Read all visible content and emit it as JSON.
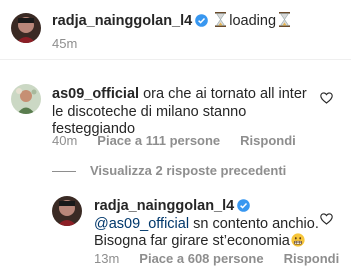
{
  "caption": {
    "username": "radja_nainggolan_l4",
    "text": "loading",
    "time": "45m",
    "icons": [
      "avatar",
      "verified-badge-icon",
      "hourglass-icon",
      "hourglass-icon"
    ]
  },
  "comments": [
    {
      "username": "as09_official",
      "text": "ora che ai tornato all inter le discoteche di milano stanno festeggiando",
      "time": "40m",
      "likes": "Piace a 111 persone",
      "reply_label": "Rispondi"
    }
  ],
  "view_replies_label": "Visualizza 2 risposte precedenti",
  "reply": {
    "username": "radja_nainggolan_l4",
    "mention": "@as09_official",
    "text_line1": " sn contento anchio.",
    "text_line2": "Bisogna far girare st’economia",
    "time": "13m",
    "likes": "Piace a 608 persone",
    "reply_label": "Rispondi"
  },
  "colors": {
    "text": "#262626",
    "muted": "#8e8e8e",
    "mention": "#00376b",
    "verified": "#3897f0"
  }
}
